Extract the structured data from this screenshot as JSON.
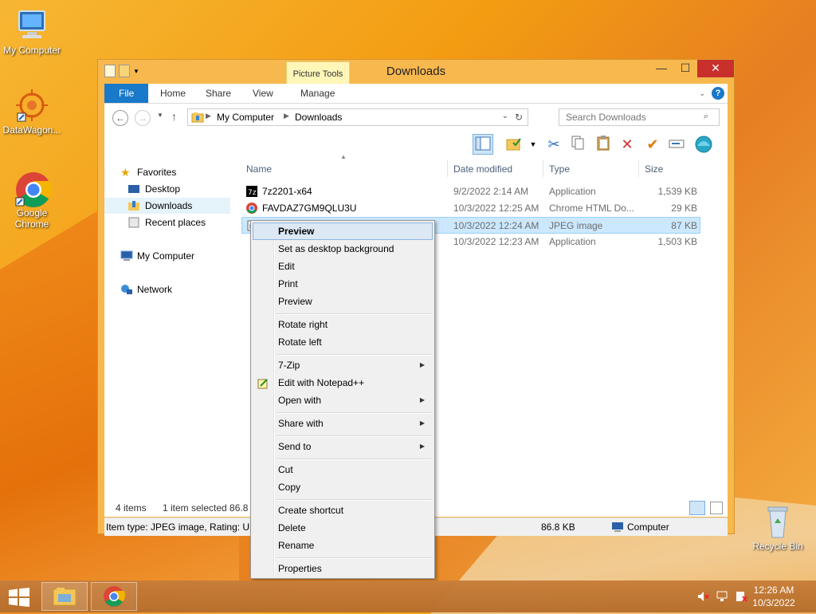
{
  "desktop": {
    "icons": [
      {
        "label": "My Computer"
      },
      {
        "label": "DataWagon..."
      },
      {
        "label": "Google Chrome"
      },
      {
        "label": "Recycle Bin"
      }
    ]
  },
  "window": {
    "title": "Downloads",
    "context_tab": "Picture Tools",
    "tabs": [
      "File",
      "Home",
      "Share",
      "View",
      "Manage"
    ],
    "address": [
      "My Computer",
      "Downloads"
    ],
    "search_placeholder": "Search Downloads",
    "nav": {
      "favorites": "Favorites",
      "desktop": "Desktop",
      "downloads": "Downloads",
      "recent": "Recent places",
      "computer": "My Computer",
      "network": "Network"
    },
    "columns": {
      "name": "Name",
      "date": "Date modified",
      "type": "Type",
      "size": "Size"
    },
    "files": [
      {
        "name": "7z2201-x64",
        "date": "9/2/2022 2:14 AM",
        "type": "Application",
        "size": "1,539 KB"
      },
      {
        "name": "FAVDAZ7GM9QLU3U",
        "date": "10/3/2022 12:25 AM",
        "type": "Chrome HTML Do...",
        "size": "29 KB"
      },
      {
        "name": "",
        "date": "10/3/2022 12:24 AM",
        "type": "JPEG image",
        "size": "87 KB"
      },
      {
        "name": "",
        "date": "10/3/2022 12:23 AM",
        "type": "Application",
        "size": "1,503 KB"
      }
    ],
    "status": {
      "items": "4 items",
      "selected": "1 item selected  86.8 KB"
    },
    "details": {
      "item_type": "Item type: JPEG image, Rating: Unr",
      "size": "86.8 KB",
      "location": "Computer"
    }
  },
  "context_menu": {
    "items": [
      "Preview",
      "Set as desktop background",
      "Edit",
      "Print",
      "Preview",
      "Rotate right",
      "Rotate left",
      "7-Zip",
      "Edit with Notepad++",
      "Open with",
      "Share with",
      "Send to",
      "Cut",
      "Copy",
      "Create shortcut",
      "Delete",
      "Rename",
      "Properties"
    ]
  },
  "taskbar": {
    "time": "12:26 AM",
    "date": "10/3/2022"
  }
}
